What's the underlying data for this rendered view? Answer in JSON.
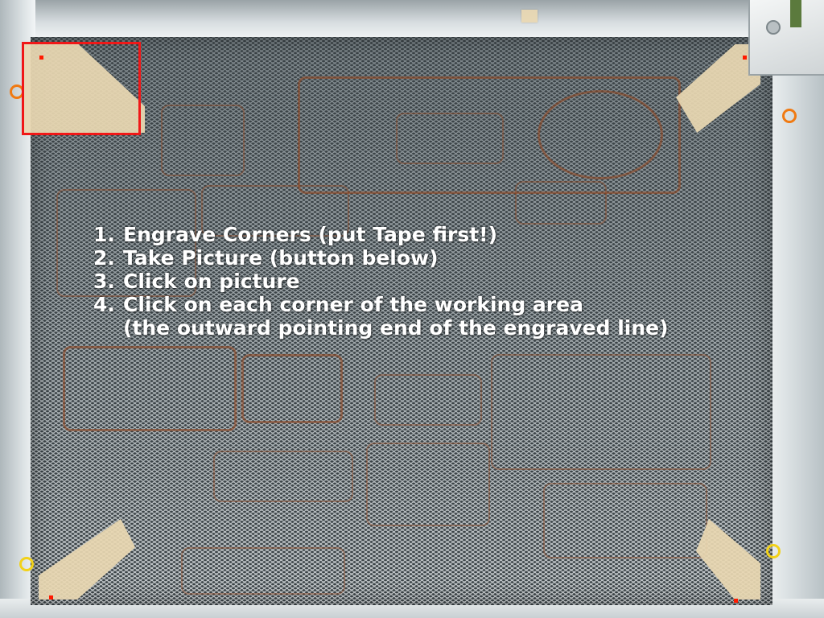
{
  "instructions": {
    "steps": [
      {
        "number": "1.",
        "text": "Engrave Corners (put Tape first!)"
      },
      {
        "number": "2.",
        "text": "Take Picture (button below)"
      },
      {
        "number": "3.",
        "text": "Click on picture"
      },
      {
        "number": "4.",
        "text": "Click on each corner of the working area"
      }
    ],
    "step4_note": "(the outward pointing end of the engraved line)"
  },
  "colors": {
    "selection_box": "#f01818",
    "corner_marker": "#ff1a00",
    "instruction_text": "#ffffff",
    "ring_orange": "#f07a12",
    "ring_yellow": "#f2d21a"
  },
  "icons": {
    "corner_marker": "red-square-dot-icon"
  }
}
